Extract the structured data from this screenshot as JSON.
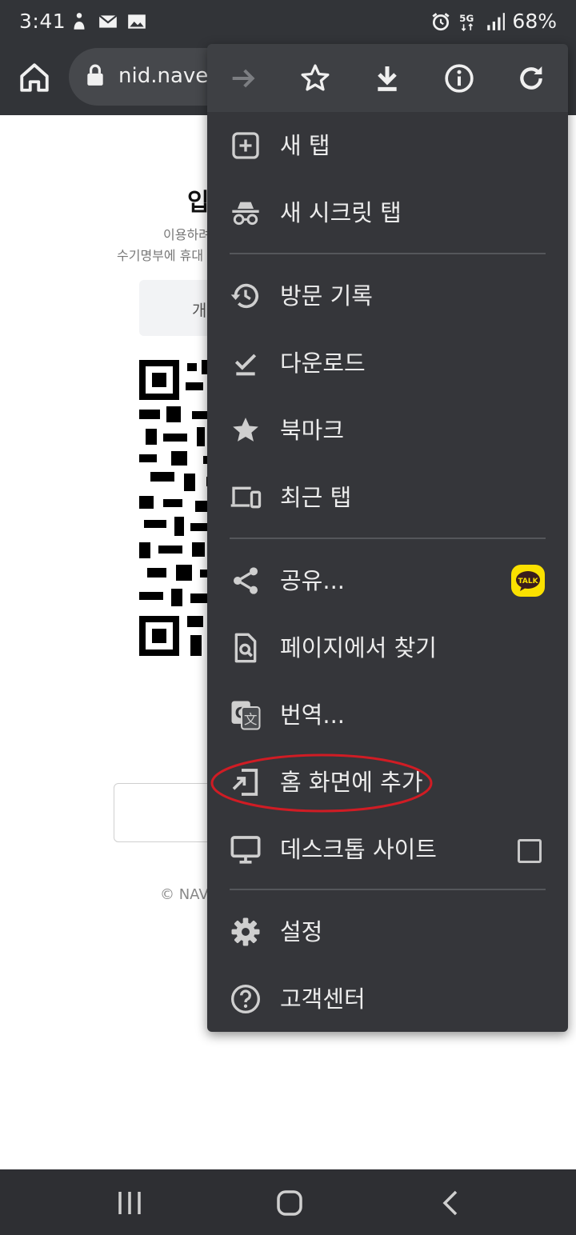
{
  "status_bar": {
    "time": "3:41",
    "battery": "68%",
    "icons_left": [
      "android-figure-icon",
      "mail-icon",
      "image-icon"
    ],
    "icons_right": [
      "alarm-icon",
      "5g-icon",
      "signal-icon"
    ]
  },
  "toolbar": {
    "url": "nid.naver"
  },
  "background_page": {
    "title": "입",
    "desc_line1": "이용하려",
    "desc_line2": "수기명부에 휴대",
    "tab_label": "개",
    "copyright": "© NAV"
  },
  "menu": {
    "icon_bar": [
      "forward-icon",
      "bookmark-star-icon",
      "download-icon",
      "info-icon",
      "reload-icon"
    ],
    "items": [
      {
        "label": "새 탭",
        "icon": "new-tab-icon"
      },
      {
        "label": "새 시크릿 탭",
        "icon": "incognito-icon"
      },
      {
        "label": "방문 기록",
        "icon": "history-icon"
      },
      {
        "label": "다운로드",
        "icon": "downloads-icon"
      },
      {
        "label": "북마크",
        "icon": "bookmarks-icon"
      },
      {
        "label": "최근 탭",
        "icon": "recent-tabs-icon"
      },
      {
        "label": "공유...",
        "icon": "share-icon",
        "badge": "TALK"
      },
      {
        "label": "페이지에서 찾기",
        "icon": "find-in-page-icon"
      },
      {
        "label": "번역...",
        "icon": "translate-icon"
      },
      {
        "label": "홈 화면에 추가",
        "icon": "add-to-home-icon"
      },
      {
        "label": "데스크톱 사이트",
        "icon": "desktop-icon",
        "checked": false
      },
      {
        "label": "설정",
        "icon": "settings-icon"
      },
      {
        "label": "고객센터",
        "icon": "help-icon"
      }
    ]
  },
  "colors": {
    "menu_bg": "#35363a",
    "menu_text": "#ececec",
    "highlight": "#d01c24",
    "kakao_yellow": "#fae100"
  }
}
